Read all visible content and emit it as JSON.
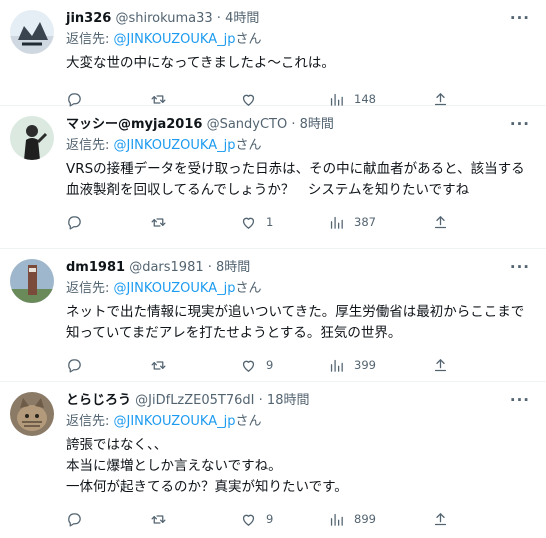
{
  "tweets": [
    {
      "display_name": "jin326",
      "handle": "@shirokuma33",
      "time": "4時間",
      "reply_prefix": "返信先: ",
      "reply_to": "@JINKOUZOUKA_jp",
      "reply_suffix": "さん",
      "text": "大変な世の中になってきましたよ〜これは。",
      "replies": "",
      "retweets": "",
      "likes": "",
      "views": "148"
    },
    {
      "display_name": "マッシー@myja2016",
      "handle": "@SandyCTO",
      "time": "8時間",
      "reply_prefix": "返信先: ",
      "reply_to": "@JINKOUZOUKA_jp",
      "reply_suffix": "さん",
      "text": "VRSの接種データを受け取った日赤は、その中に献血者があると、該当する血液製剤を回収してるんでしょうか？　システムを知りたいですね",
      "replies": "",
      "retweets": "",
      "likes": "1",
      "views": "387"
    },
    {
      "display_name": "dm1981",
      "handle": "@dars1981",
      "time": "8時間",
      "reply_prefix": "返信先: ",
      "reply_to": "@JINKOUZOUKA_jp",
      "reply_suffix": "さん",
      "text": "ネットで出た情報に現実が追いついてきた。厚生労働省は最初からここまで知っていてまだアレを打たせようとする。狂気の世界。",
      "replies": "",
      "retweets": "",
      "likes": "9",
      "views": "399"
    },
    {
      "display_name": "とらじろう",
      "handle": "@JiDfLzZE05T76dI",
      "time": "18時間",
      "reply_prefix": "返信先: ",
      "reply_to": "@JINKOUZOUKA_jp",
      "reply_suffix": "さん",
      "text": "誇張ではなく、、\n本当に爆増としか言えないですね。\n一体何が起きてるのか？真実が知りたいです。",
      "replies": "",
      "retweets": "",
      "likes": "9",
      "views": "899"
    }
  ],
  "colors": {
    "link": "#1d9bf0",
    "secondary_text": "#536471",
    "primary_text": "#0f1419",
    "divider": "#eff3f4"
  },
  "icons": [
    "reply-icon",
    "retweet-icon",
    "like-icon",
    "views-icon",
    "share-icon",
    "more-icon"
  ]
}
